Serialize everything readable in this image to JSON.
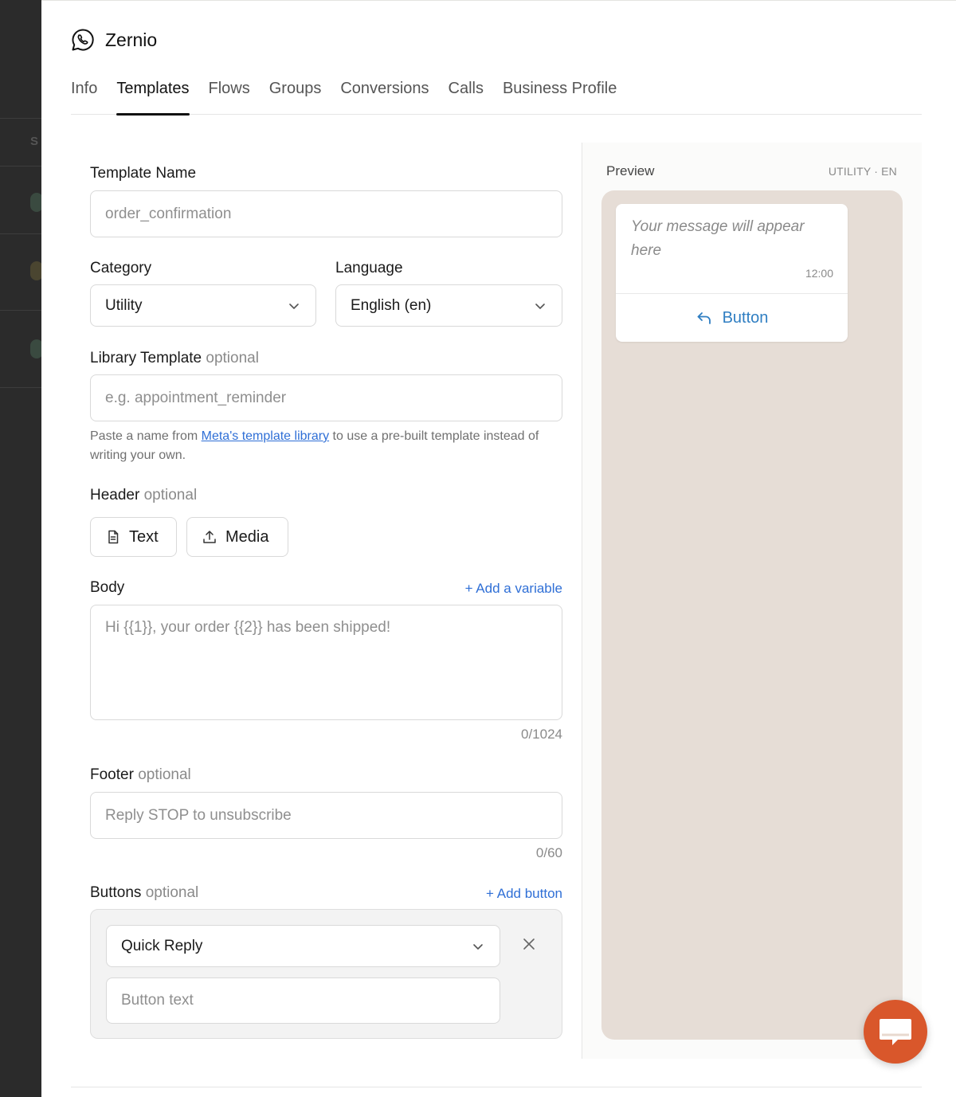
{
  "brand": {
    "name": "Zernio",
    "icon": "whatsapp-icon"
  },
  "tabs": [
    {
      "label": "Info",
      "active": false
    },
    {
      "label": "Templates",
      "active": true
    },
    {
      "label": "Flows",
      "active": false
    },
    {
      "label": "Groups",
      "active": false
    },
    {
      "label": "Conversions",
      "active": false
    },
    {
      "label": "Calls",
      "active": false
    },
    {
      "label": "Business Profile",
      "active": false
    }
  ],
  "form": {
    "template_name": {
      "label": "Template Name",
      "value": "",
      "placeholder": "order_confirmation"
    },
    "category": {
      "label": "Category",
      "value": "Utility"
    },
    "language": {
      "label": "Language",
      "value": "English (en)"
    },
    "library_template": {
      "label": "Library Template",
      "optional": "optional",
      "value": "",
      "placeholder": "e.g. appointment_reminder",
      "help_prefix": "Paste a name from ",
      "help_link": "Meta's template library",
      "help_suffix": " to use a pre-built template instead of writing your own."
    },
    "header": {
      "label": "Header",
      "optional": "optional",
      "text_button": "Text",
      "media_button": "Media"
    },
    "body": {
      "label": "Body",
      "add_variable": "+ Add a variable",
      "value": "",
      "placeholder": "Hi {{1}}, your order {{2}} has been shipped!",
      "counter": "0/1024"
    },
    "footer": {
      "label": "Footer",
      "optional": "optional",
      "value": "",
      "placeholder": "Reply STOP to unsubscribe",
      "counter": "0/60"
    },
    "buttons": {
      "label": "Buttons",
      "optional": "optional",
      "add_button": "+ Add button",
      "type": "Quick Reply",
      "text_value": "",
      "text_placeholder": "Button text"
    }
  },
  "preview": {
    "title": "Preview",
    "meta": "UTILITY · EN",
    "message_placeholder": "Your message will appear here",
    "time": "12:00",
    "button_label": "Button"
  },
  "colors": {
    "accent": "#2f6fd6",
    "chat_bg": "#e6ddd6",
    "fab": "#d9572b",
    "preview_button": "#2f7ec2"
  }
}
